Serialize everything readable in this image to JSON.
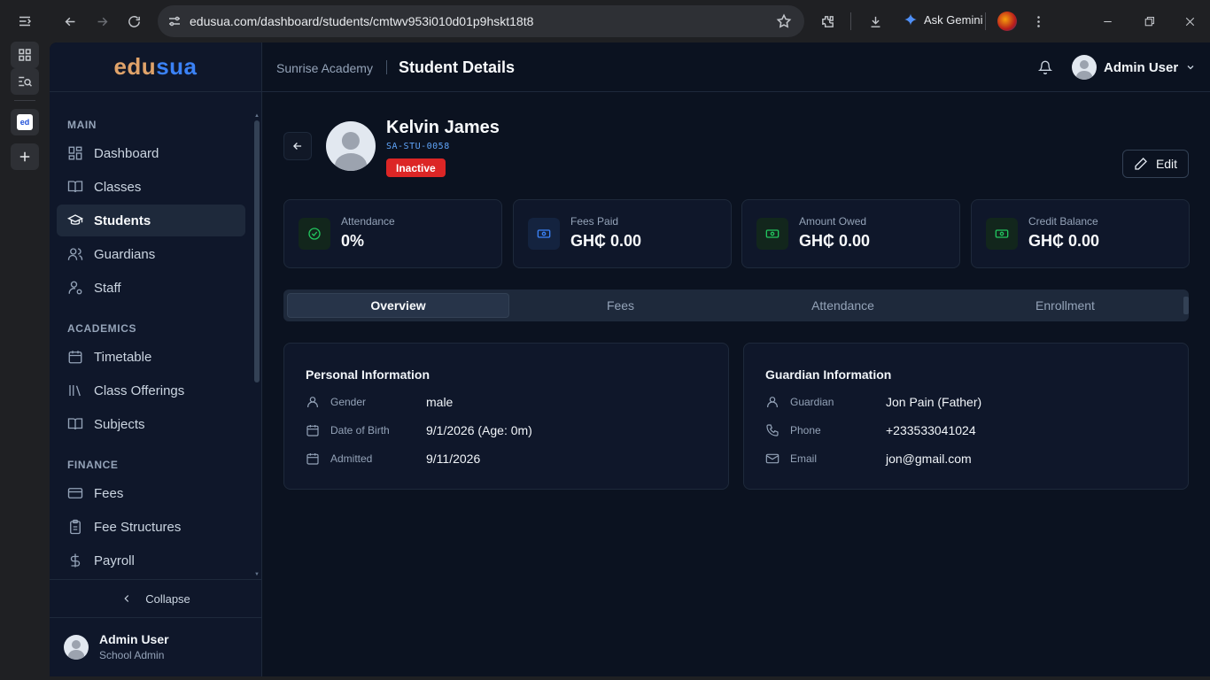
{
  "browser": {
    "url": "edusua.com/dashboard/students/cmtwv953i010d01p9hskt18t8",
    "gemini_label": "Ask Gemini",
    "tab_favicon_text": "ed"
  },
  "brand": {
    "part1": "edu",
    "part2": "sua"
  },
  "sidebar": {
    "sections": [
      {
        "label": "MAIN",
        "items": [
          {
            "label": "Dashboard",
            "icon": "dashboard-icon"
          },
          {
            "label": "Classes",
            "icon": "book-icon"
          },
          {
            "label": "Students",
            "icon": "graduation-cap-icon",
            "active": true
          },
          {
            "label": "Guardians",
            "icon": "users-icon"
          },
          {
            "label": "Staff",
            "icon": "user-cog-icon"
          }
        ]
      },
      {
        "label": "ACADEMICS",
        "items": [
          {
            "label": "Timetable",
            "icon": "calendar-icon"
          },
          {
            "label": "Class Offerings",
            "icon": "library-icon"
          },
          {
            "label": "Subjects",
            "icon": "book-open-icon"
          }
        ]
      },
      {
        "label": "FINANCE",
        "items": [
          {
            "label": "Fees",
            "icon": "credit-card-icon"
          },
          {
            "label": "Fee Structures",
            "icon": "clipboard-icon"
          },
          {
            "label": "Payroll",
            "icon": "dollar-icon"
          }
        ]
      }
    ],
    "collapse_label": "Collapse",
    "user": {
      "name": "Admin User",
      "role": "School Admin"
    }
  },
  "header": {
    "school": "Sunrise Academy",
    "title": "Student Details",
    "user_name": "Admin User"
  },
  "student": {
    "name": "Kelvin James",
    "id": "SA-STU-0058",
    "status": "Inactive",
    "edit_label": "Edit"
  },
  "stats": [
    {
      "label": "Attendance",
      "value": "0%",
      "icon": "check-circle-icon",
      "color": "#22c55e"
    },
    {
      "label": "Fees Paid",
      "value": "GH₵ 0.00",
      "icon": "banknote-icon",
      "color": "#3b82f6"
    },
    {
      "label": "Amount Owed",
      "value": "GH₵ 0.00",
      "icon": "banknote-icon",
      "color": "#22c55e"
    },
    {
      "label": "Credit Balance",
      "value": "GH₵ 0.00",
      "icon": "banknote-icon",
      "color": "#22c55e"
    }
  ],
  "tabs": [
    {
      "label": "Overview",
      "active": true
    },
    {
      "label": "Fees"
    },
    {
      "label": "Attendance"
    },
    {
      "label": "Enrollment"
    }
  ],
  "personal": {
    "title": "Personal Information",
    "rows": [
      {
        "label": "Gender",
        "value": "male",
        "icon": "user-icon"
      },
      {
        "label": "Date of Birth",
        "value": "9/1/2026 (Age: 0m)",
        "icon": "calendar-icon"
      },
      {
        "label": "Admitted",
        "value": "9/11/2026",
        "icon": "calendar-icon"
      }
    ]
  },
  "guardian": {
    "title": "Guardian Information",
    "rows": [
      {
        "label": "Guardian",
        "value": "Jon Pain (Father)",
        "icon": "user-icon"
      },
      {
        "label": "Phone",
        "value": "+233533041024",
        "icon": "phone-icon"
      },
      {
        "label": "Email",
        "value": "jon@gmail.com",
        "icon": "mail-icon"
      }
    ]
  }
}
